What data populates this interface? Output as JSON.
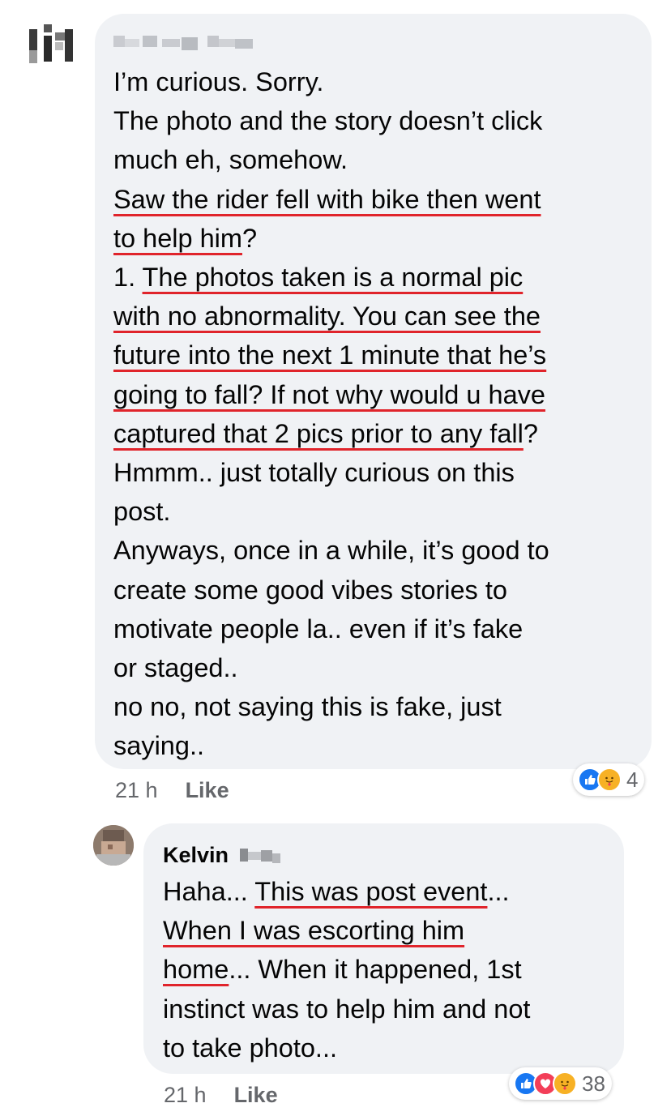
{
  "comments": [
    {
      "author": "",
      "lines": [
        {
          "parts": [
            {
              "t": "I’m curious. Sorry.",
              "u": false
            }
          ]
        },
        {
          "parts": [
            {
              "t": "The photo and the story doesn’t click",
              "u": false
            }
          ]
        },
        {
          "parts": [
            {
              "t": "much eh, somehow.",
              "u": false
            }
          ]
        },
        {
          "parts": [
            {
              "t": "Saw the rider fell with bike then went",
              "u": true
            }
          ]
        },
        {
          "parts": [
            {
              "t": "to help him",
              "u": true
            },
            {
              "t": "?",
              "u": false
            }
          ]
        },
        {
          "parts": [
            {
              "t": "1. ",
              "u": false
            },
            {
              "t": "The photos taken is a normal pic",
              "u": true
            }
          ]
        },
        {
          "parts": [
            {
              "t": "with no abnormality. You can see the",
              "u": true
            }
          ]
        },
        {
          "parts": [
            {
              "t": "future into the next 1 minute that he’s",
              "u": true
            }
          ]
        },
        {
          "parts": [
            {
              "t": "going to fall? If not why would u have",
              "u": true
            }
          ]
        },
        {
          "parts": [
            {
              "t": "captured that 2 pics prior to any fall",
              "u": true
            },
            {
              "t": "?",
              "u": false
            }
          ]
        },
        {
          "parts": [
            {
              "t": "Hmmm.. just totally curious on this",
              "u": false
            }
          ]
        },
        {
          "parts": [
            {
              "t": "post.",
              "u": false
            }
          ]
        },
        {
          "parts": [
            {
              "t": "Anyways, once in a while, it’s good to",
              "u": false
            }
          ]
        },
        {
          "parts": [
            {
              "t": "create some good vibes stories to",
              "u": false
            }
          ]
        },
        {
          "parts": [
            {
              "t": "motivate people la.. even if it’s fake",
              "u": false
            }
          ]
        },
        {
          "parts": [
            {
              "t": "or staged..",
              "u": false
            }
          ]
        },
        {
          "parts": [
            {
              "t": "no no, not saying this is fake, just",
              "u": false
            }
          ]
        },
        {
          "parts": [
            {
              "t": "saying..",
              "u": false
            }
          ]
        }
      ],
      "time": "21 h",
      "like_label": "Like",
      "reactions": [
        "like-icon",
        "care-icon"
      ],
      "reaction_count": "4"
    },
    {
      "author": "Kelvin",
      "lines": [
        {
          "parts": [
            {
              "t": "Haha... ",
              "u": false
            },
            {
              "t": "This was post event",
              "u": true
            },
            {
              "t": "...",
              "u": false
            }
          ]
        },
        {
          "parts": [
            {
              "t": "When I was escorting him",
              "u": true
            }
          ]
        },
        {
          "parts": [
            {
              "t": "home",
              "u": true
            },
            {
              "t": "... When it happened, 1st",
              "u": false
            }
          ]
        },
        {
          "parts": [
            {
              "t": "instinct was to help him and not",
              "u": false
            }
          ]
        },
        {
          "parts": [
            {
              "t": "to take photo...",
              "u": false
            }
          ]
        }
      ],
      "time": "21 h",
      "like_label": "Like",
      "reactions": [
        "like-icon",
        "love-icon",
        "care-icon"
      ],
      "reaction_count": "38"
    }
  ],
  "colors": {
    "bubble": "#f0f2f5",
    "underline": "#e0242b",
    "meta": "#65676b",
    "like": "#1877f2",
    "love": "#f33e58",
    "care": "#f7b125"
  }
}
